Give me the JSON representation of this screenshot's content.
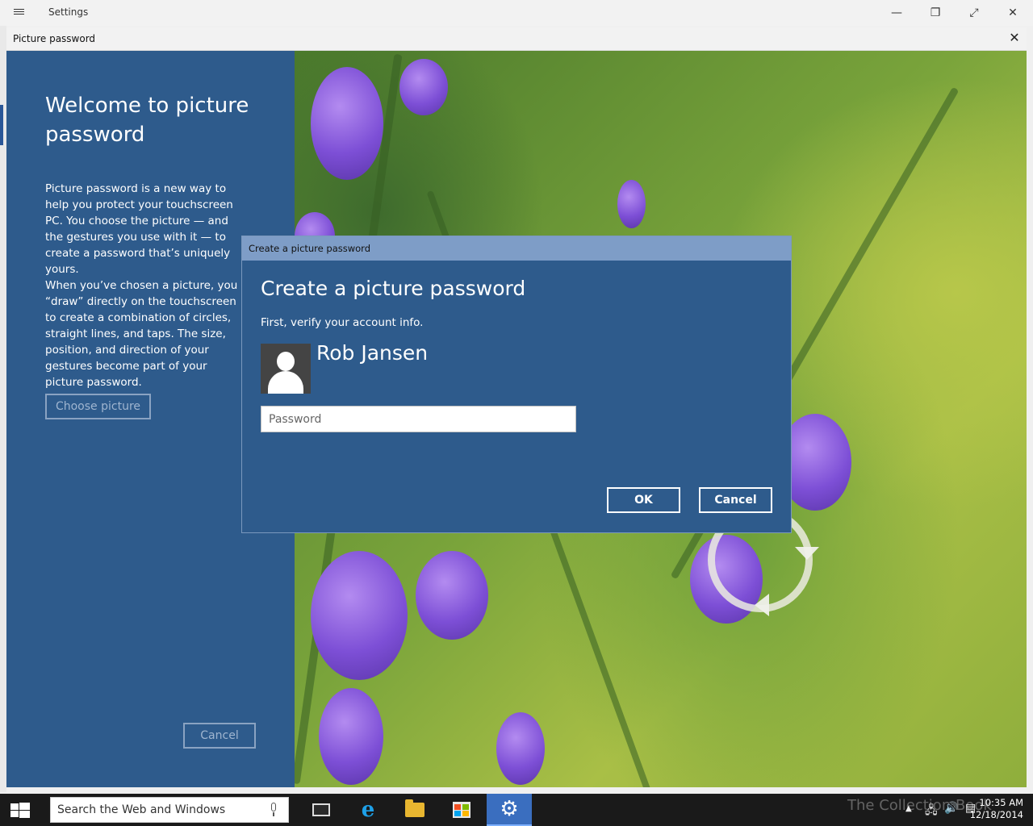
{
  "settings_window": {
    "title": "Settings",
    "controls": {
      "minimize": "—",
      "restore": "❐",
      "fullscreen": "⤢",
      "close": "✕"
    }
  },
  "picture_password_window": {
    "title": "Picture password",
    "close": "✕",
    "welcome_title": "Welcome to picture password",
    "paragraph1": "Picture password is a new way to help you protect your touchscreen PC. You choose the picture — and the gestures you use with it — to create a password that’s uniquely yours.",
    "paragraph2": "When you’ve chosen a picture, you “draw” directly on the touchscreen to create a combination of circles, straight lines, and taps. The size, position, and direction of your gestures become part of your picture password.",
    "choose_picture_label": "Choose picture",
    "cancel_label": "Cancel"
  },
  "dialog": {
    "title": "Create a picture password",
    "heading": "Create a picture password",
    "subtitle": "First, verify your account info.",
    "user_name": "Rob Jansen",
    "password_placeholder": "Password",
    "password_value": "",
    "ok_label": "OK",
    "cancel_label": "Cancel"
  },
  "taskbar": {
    "search_text": "Search the Web and Windows",
    "watermark": "The Collection Book",
    "time": "10:35 AM",
    "date": "12/18/2014",
    "apps": [
      "task-view",
      "internet-explorer",
      "file-explorer",
      "store",
      "settings"
    ]
  },
  "colors": {
    "panel_blue": "#2e5b8c",
    "dialog_titlebar": "#7e9dc7",
    "taskbar": "#1a1a1a",
    "active_taskbar_item": "#3a6ebf"
  }
}
